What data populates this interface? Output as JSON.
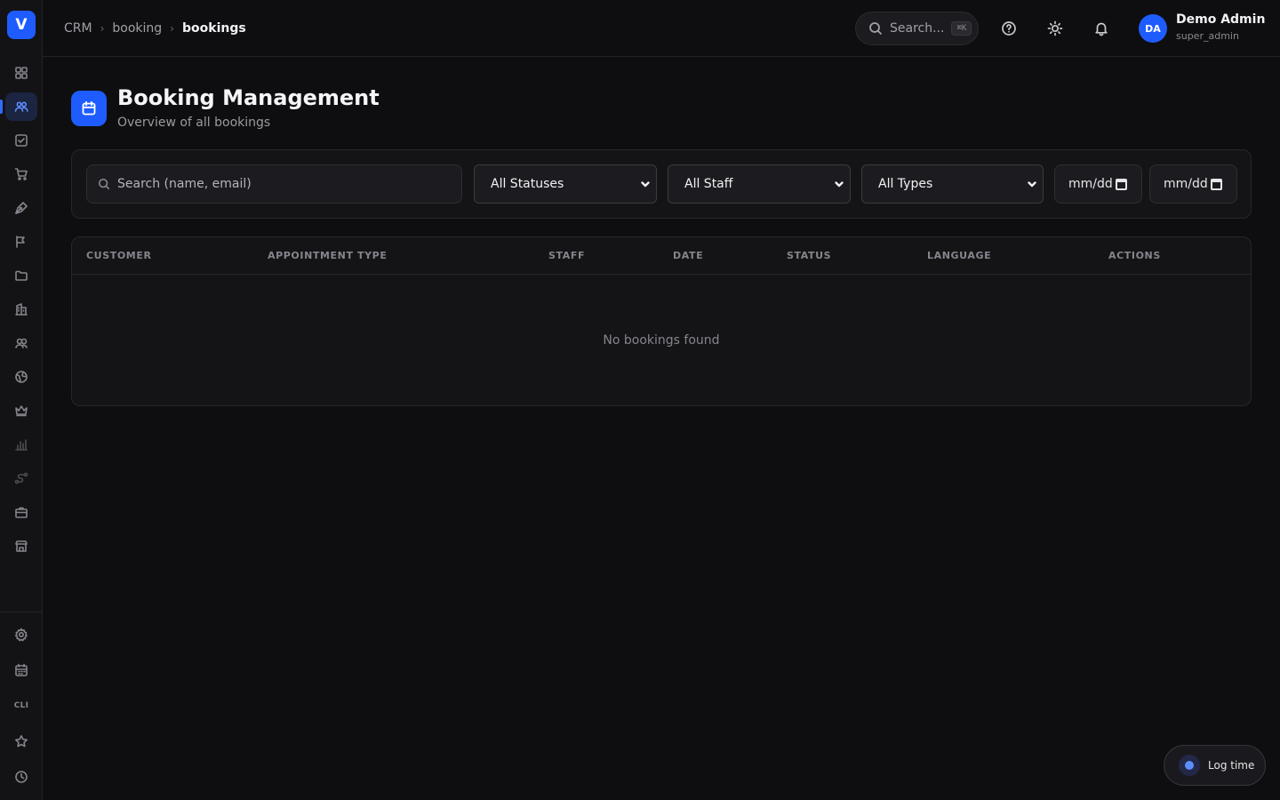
{
  "sidebar": {
    "logo_letter": "V",
    "nav_items": [
      {
        "icon": "dashboard-grid-icon"
      },
      {
        "icon": "users-icon",
        "active": true
      },
      {
        "icon": "check-square-icon"
      },
      {
        "icon": "shopping-cart-icon"
      },
      {
        "icon": "pen-tool-icon"
      },
      {
        "icon": "flag-icon"
      },
      {
        "icon": "folder-icon"
      },
      {
        "icon": "building-icon"
      },
      {
        "icon": "contacts-icon"
      },
      {
        "icon": "globe-icon"
      },
      {
        "icon": "crown-icon"
      },
      {
        "icon": "bar-chart-icon"
      },
      {
        "icon": "route-icon"
      },
      {
        "icon": "briefcase-icon"
      },
      {
        "icon": "store-icon"
      }
    ],
    "bottom_items": [
      {
        "icon": "settings-gear-icon"
      },
      {
        "icon": "calendar-grid-icon"
      },
      {
        "label": "CLI"
      },
      {
        "icon": "star-icon"
      },
      {
        "icon": "clock-icon"
      }
    ]
  },
  "header": {
    "breadcrumb": [
      "CRM",
      "booking",
      "bookings"
    ],
    "search_label": "Search...",
    "search_shortcut": "⌘K",
    "icons": [
      "help-circle-icon",
      "sun-icon",
      "bell-icon"
    ],
    "user": {
      "initials": "DA",
      "name": "Demo Admin",
      "role": "super_admin"
    }
  },
  "page": {
    "title": "Booking Management",
    "subtitle": "Overview of all bookings"
  },
  "filters": {
    "search_placeholder": "Search (name, email)",
    "status_selected": "All Statuses",
    "staff_selected": "All Staff",
    "type_selected": "All Types",
    "date_from_placeholder": "mm/dd",
    "date_to_placeholder": "mm/dd"
  },
  "table": {
    "columns": [
      "CUSTOMER",
      "APPOINTMENT TYPE",
      "STAFF",
      "DATE",
      "STATUS",
      "LANGUAGE",
      "ACTIONS"
    ],
    "empty_message": "No bookings found"
  },
  "log_time": {
    "label": "Log time"
  },
  "colors": {
    "accent": "#1f5cff",
    "background": "#0e0e10",
    "panel": "#141417"
  }
}
